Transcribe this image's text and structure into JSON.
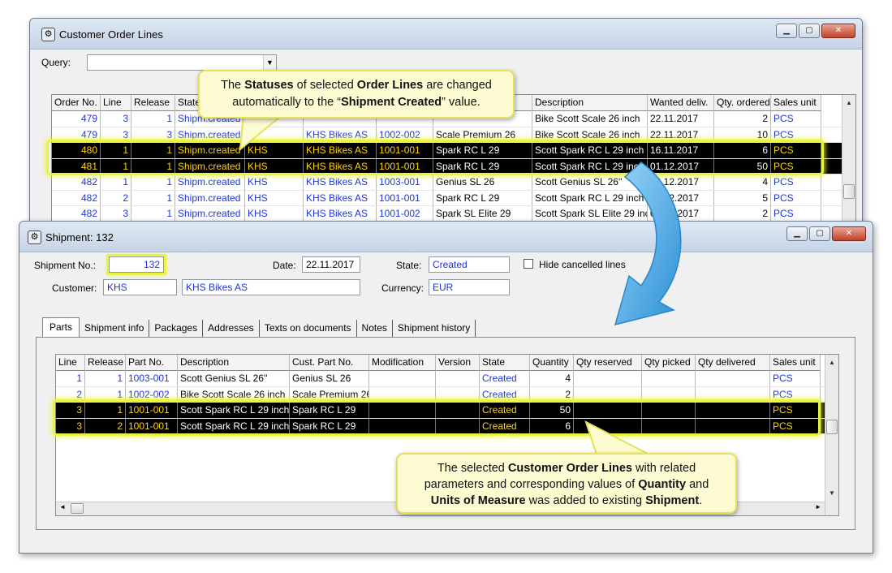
{
  "win1": {
    "title": "Customer Order Lines",
    "query_label": "Query:",
    "query_value": "",
    "columns": [
      "Order No.",
      "Line",
      "Release",
      "State",
      "",
      "",
      "",
      "",
      "Description",
      "Wanted deliv.",
      "Qty. ordered",
      "Sales unit"
    ],
    "rows": [
      [
        "479",
        "3",
        "1",
        "Shipm.created",
        "",
        "",
        "",
        "",
        "Bike Scott Scale 26 inch",
        "22.11.2017",
        "2",
        "PCS"
      ],
      [
        "479",
        "3",
        "3",
        "Shipm.created",
        "",
        "KHS Bikes AS",
        "1002-002",
        "Scale Premium 26",
        "Bike Scott Scale 26 inch",
        "22.11.2017",
        "10",
        "PCS"
      ],
      [
        "480",
        "1",
        "1",
        "Shipm.created",
        "KHS",
        "KHS Bikes AS",
        "1001-001",
        "Spark RC L 29",
        "Scott Spark RC L 29 inch",
        "16.11.2017",
        "6",
        "PCS"
      ],
      [
        "481",
        "1",
        "1",
        "Shipm.created",
        "KHS",
        "KHS Bikes AS",
        "1001-001",
        "Spark RC L 29",
        "Scott Spark RC L 29 inc",
        "01.12.2017",
        "50",
        "PCS"
      ],
      [
        "482",
        "1",
        "1",
        "Shipm.created",
        "KHS",
        "KHS Bikes AS",
        "1003-001",
        "Genius SL 26",
        "Scott Genius SL 26''",
        "26.12.2017",
        "4",
        "PCS"
      ],
      [
        "482",
        "2",
        "1",
        "Shipm.created",
        "KHS",
        "KHS Bikes AS",
        "1001-001",
        "Spark RC L 29",
        "Scott Spark RC L 29 inch",
        "01.12.2017",
        "5",
        "PCS"
      ],
      [
        "482",
        "3",
        "1",
        "Shipm.created",
        "KHS",
        "KHS Bikes AS",
        "1001-002",
        "Spark SL Elite 29",
        "Scott Spark SL Elite 29 inch",
        "01.12.2017",
        "2",
        "PCS"
      ]
    ]
  },
  "win2": {
    "title": "Shipment: 132",
    "shipment_no_label": "Shipment No.:",
    "shipment_no": "132",
    "date_label": "Date:",
    "date": "22.11.2017",
    "state_label": "State:",
    "state": "Created",
    "hide_cancelled_label": "Hide cancelled lines",
    "customer_label": "Customer:",
    "customer_code": "KHS",
    "customer_name": "KHS Bikes AS",
    "currency_label": "Currency:",
    "currency": "EUR",
    "tabs": [
      "Parts",
      "Shipment info",
      "Packages",
      "Addresses",
      "Texts on documents",
      "Notes",
      "Shipment history"
    ],
    "columns": [
      "Line",
      "Release",
      "Part No.",
      "Description",
      "Cust. Part No.",
      "Modification",
      "Version",
      "State",
      "Quantity",
      "Qty reserved",
      "Qty picked",
      "Qty delivered",
      "Sales unit"
    ],
    "rows": [
      [
        "1",
        "1",
        "1003-001",
        "Scott Genius SL 26''",
        "Genius SL 26",
        "",
        "",
        "Created",
        "4",
        "",
        "",
        "",
        "PCS"
      ],
      [
        "2",
        "1",
        "1002-002",
        "Bike Scott Scale 26 inch",
        "Scale Premium 26",
        "",
        "",
        "Created",
        "2",
        "",
        "",
        "",
        "PCS"
      ],
      [
        "3",
        "1",
        "1001-001",
        "Scott Spark RC L 29 inch",
        "Spark RC L 29",
        "",
        "",
        "Created",
        "50",
        "",
        "",
        "",
        "PCS"
      ],
      [
        "3",
        "2",
        "1001-001",
        "Scott Spark RC L 29 inch",
        "Spark RC L 29",
        "",
        "",
        "Created",
        "6",
        "",
        "",
        "",
        "PCS"
      ]
    ]
  },
  "callout_top": {
    "t1": "The ",
    "b1": "Statuses",
    "t2": " of selected ",
    "b2": "Order Lines",
    "t3": " are changed",
    "t4": "automatically to the “",
    "b3": "Shipment Created",
    "t5": "” value."
  },
  "callout_bottom": {
    "t1": "The selected ",
    "b1": "Customer Order Lines",
    "t2": " with related",
    "t3": "parameters and corresponding values of ",
    "b2": "Quantity",
    "t4": " and",
    "b3": "Units of Measure",
    "t5": " was added to existing ",
    "b4": "Shipment",
    "t6": "."
  },
  "colors": {
    "highlight": "#e9f340",
    "link_blue": "#1f35d6",
    "callout_bg": "#fdfbd2",
    "arrow": "#3aa8e8"
  }
}
